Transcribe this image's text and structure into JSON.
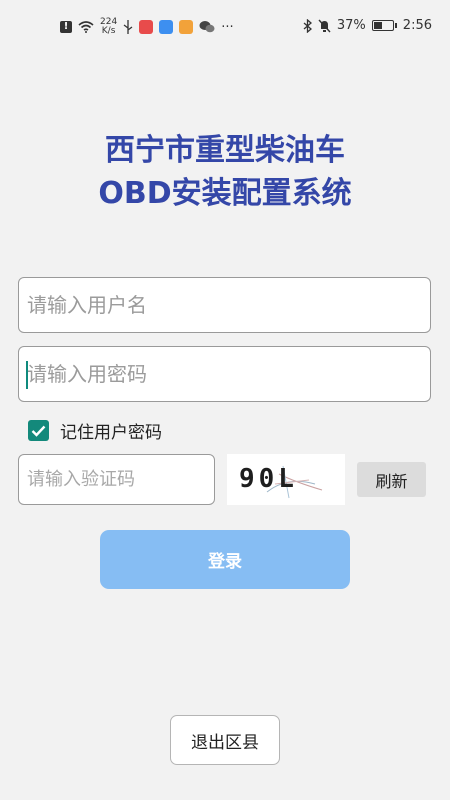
{
  "status_bar": {
    "net_speed_value": "224",
    "net_speed_unit": "K/s",
    "more": "···",
    "battery": "37%",
    "time": "2:56"
  },
  "title": {
    "line1": "西宁市重型柴油车",
    "line2": "OBD安装配置系统"
  },
  "form": {
    "username_placeholder": "请输入用户名",
    "password_placeholder": "请输入用密码",
    "remember_label": "记住用户密码",
    "remember_checked": true,
    "captcha_placeholder": "请输入验证码",
    "captcha_text": "90L",
    "refresh_label": "刷新",
    "login_label": "登录"
  },
  "footer": {
    "exit_label": "退出区县"
  },
  "colors": {
    "title": "#3447a8",
    "accent": "#13897b",
    "login_button": "#86bdf3"
  }
}
